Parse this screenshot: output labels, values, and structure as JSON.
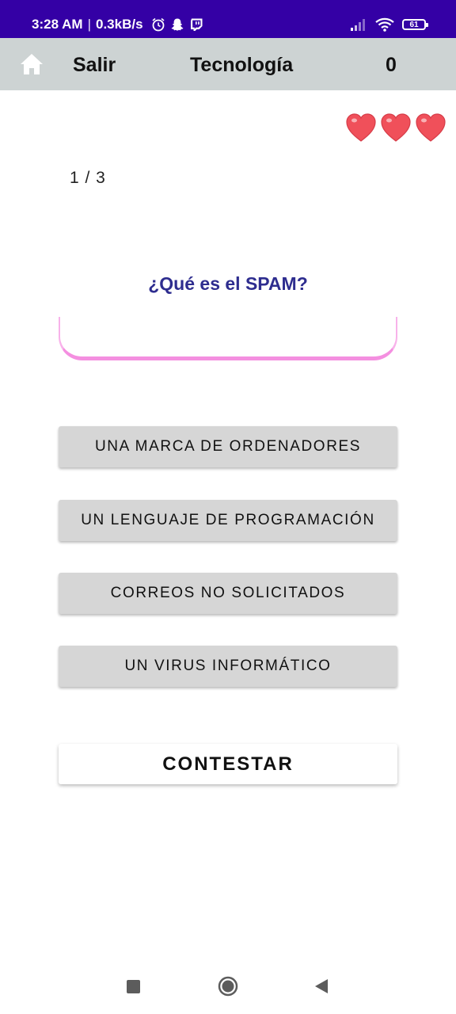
{
  "status_bar": {
    "time": "3:28 AM",
    "network_speed": "0.3kB/s",
    "battery_level": "61",
    "left_icons": [
      "alarm-icon",
      "snapchat-icon",
      "twitch-icon"
    ],
    "right_icons": [
      "signal-icon",
      "wifi-icon",
      "battery-icon"
    ],
    "background_color": "#3400a5"
  },
  "header": {
    "home_icon": "home-icon",
    "exit_label": "Salir",
    "category": "Tecnología",
    "score": "0",
    "background_color": "#cdd3d3"
  },
  "lives": {
    "count": 3,
    "icon": "heart-icon",
    "color": "#f0505a"
  },
  "quiz": {
    "progress": "1 / 3",
    "question": "¿Qué es el SPAM?",
    "question_color": "#2e2d8f",
    "options": [
      "UNA MARCA DE ORDENADORES",
      "UN LENGUAJE DE PROGRAMACIÓN",
      "CORREOS NO SOLICITADOS",
      "UN VIRUS INFORMÁTICO"
    ],
    "submit_label": "CONTESTAR"
  },
  "nav_bar": {
    "buttons": [
      "recents-button",
      "home-button",
      "back-button"
    ]
  }
}
